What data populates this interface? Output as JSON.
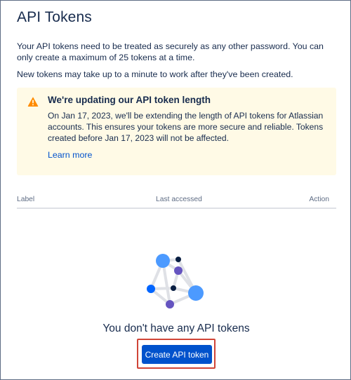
{
  "page": {
    "title": "API Tokens",
    "intro": "Your API tokens need to be treated as securely as any other password. You can only create a maximum of 25 tokens at a time.",
    "intro_note": "New tokens may take up to a minute to work after they've been created."
  },
  "notice": {
    "icon": "warning-icon",
    "title": "We're updating our API token length",
    "body": "On Jan 17, 2023, we'll be extending the length of API tokens for Atlassian accounts. This ensures your tokens are more secure and reliable. Tokens created before Jan 17, 2023 will not be affected.",
    "link_label": "Learn more",
    "background_color": "#fffae6",
    "icon_color": "#ff8b00"
  },
  "table": {
    "columns": [
      "Label",
      "Last accessed",
      "Action"
    ]
  },
  "empty_state": {
    "illustration": "token-network-illustration",
    "title": "You don't have any API tokens",
    "button_label": "Create API token",
    "button_color": "#0052cc",
    "highlight_color": "#d04437"
  }
}
